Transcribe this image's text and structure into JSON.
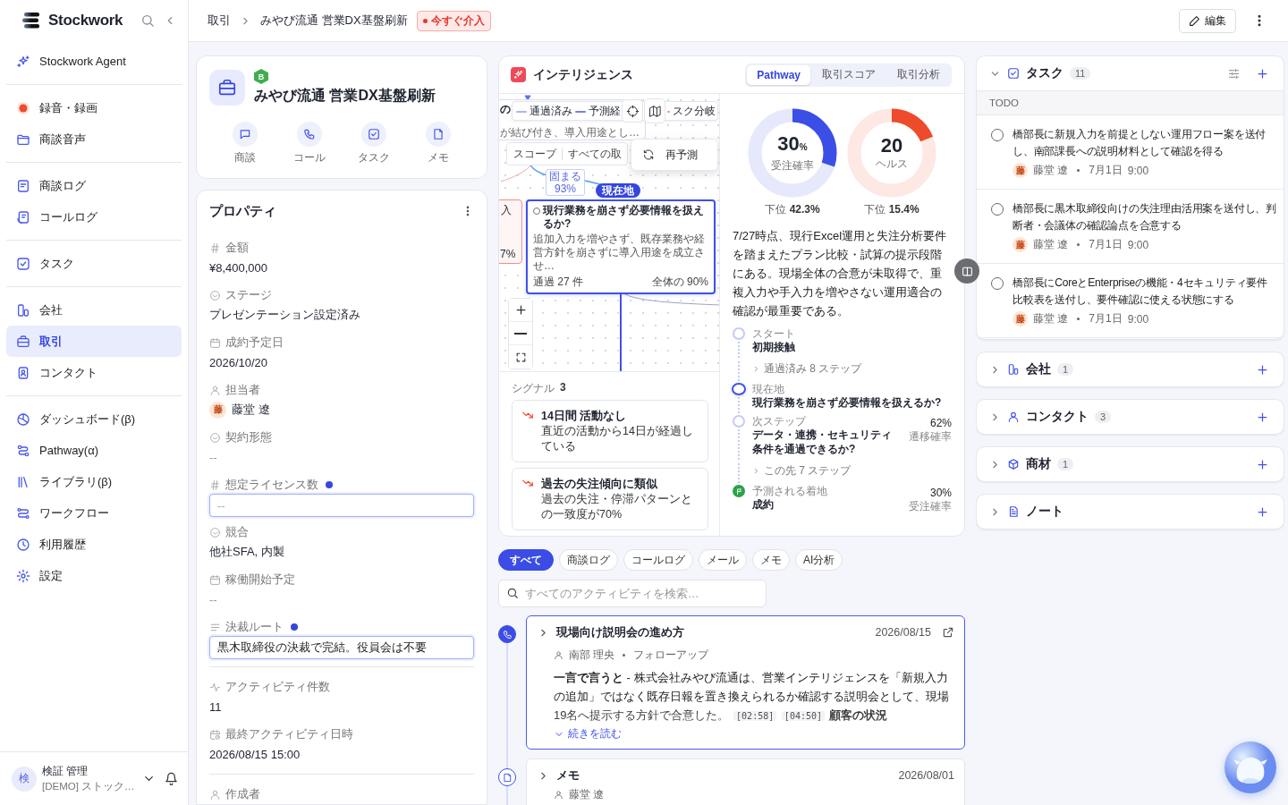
{
  "sidebar": {
    "brand": "Stockwork",
    "groups": [
      {
        "items": [
          {
            "label": "Stockwork Agent",
            "selected": false
          }
        ]
      },
      {
        "items": [
          {
            "label": "録音・録画",
            "selected": false
          },
          {
            "label": "商談音声",
            "selected": false
          }
        ]
      },
      {
        "items": [
          {
            "label": "商談ログ",
            "selected": false
          },
          {
            "label": "コールログ",
            "selected": false
          }
        ]
      },
      {
        "items": [
          {
            "label": "タスク",
            "selected": false
          }
        ]
      },
      {
        "items": [
          {
            "label": "会社",
            "selected": false
          },
          {
            "label": "取引",
            "selected": true
          },
          {
            "label": "コンタクト",
            "selected": false
          }
        ]
      },
      {
        "items": [
          {
            "label": "ダッシュボード(β)",
            "selected": false
          },
          {
            "label": "Pathway(α)",
            "selected": false
          },
          {
            "label": "ライブラリ(β)",
            "selected": false
          },
          {
            "label": "ワークフロー",
            "selected": false
          },
          {
            "label": "利用履歴",
            "selected": false
          },
          {
            "label": "設定",
            "selected": false
          }
        ]
      }
    ],
    "user": {
      "initial": "検",
      "name": "検証 管理",
      "org": "[DEMO] ストック…"
    }
  },
  "topbar": {
    "breadcrumb": [
      "取引",
      "みやび流通 営業DX基盤刷新"
    ],
    "alert": "今すぐ介入",
    "edit_button": "編集"
  },
  "deal": {
    "rank": "B",
    "title": "みやび流通 営業DX基盤刷新",
    "actions": [
      "商談",
      "コール",
      "タスク",
      "メモ"
    ]
  },
  "properties": {
    "title": "プロパティ",
    "groups": [
      {
        "fields": [
          {
            "kind": "number",
            "label": "金額",
            "value": "¥8,400,000"
          },
          {
            "kind": "select",
            "label": "ステージ",
            "value": "プレゼンテーション設定済み"
          },
          {
            "kind": "date",
            "label": "成約予定日",
            "value": "2026/10/20"
          },
          {
            "kind": "user",
            "label": "担当者",
            "value": "藤堂 遼",
            "initial": "藤"
          },
          {
            "kind": "select",
            "label": "契約形態",
            "value": "--"
          },
          {
            "kind": "number",
            "label": "想定ライセンス数",
            "editing": true,
            "placeholder": "--"
          },
          {
            "kind": "select",
            "label": "競合",
            "value": "他社SFA, 内製"
          },
          {
            "kind": "date",
            "label": "稼働開始予定",
            "value": "--"
          },
          {
            "kind": "text",
            "label": "決裁ルート",
            "editing": true,
            "value": "黒木取締役の決裁で完結。役員会は不要"
          }
        ]
      },
      {
        "fields": [
          {
            "kind": "activity",
            "label": "アクティビティ件数",
            "value": "11"
          },
          {
            "kind": "datetime",
            "label": "最終アクティビティ日時",
            "value": "2026/08/15 15:00"
          }
        ]
      },
      {
        "fields": [
          {
            "kind": "user",
            "label": "作成者"
          }
        ]
      }
    ]
  },
  "intelligence": {
    "title": "インテリジェンス",
    "tabs": [
      {
        "label": "Pathway",
        "selected": true
      },
      {
        "label": "取引スコア",
        "selected": false
      },
      {
        "label": "取引分析",
        "selected": false
      }
    ],
    "map": {
      "legend": [
        {
          "kind": "passed",
          "label": "通過済み"
        },
        {
          "kind": "predicted",
          "label": "予測経"
        },
        {
          "kind": "risk",
          "label": "スク分岐"
        }
      ],
      "scope": {
        "label": "スコープ",
        "value": "すべての取"
      },
      "menu": [
        "再予測"
      ],
      "edge_label": {
        "text": "固まる",
        "value": "93%"
      },
      "nodes": [
        {
          "kind": "partial-top",
          "title": "の",
          "description": "が結び付き、導入用途とし…"
        },
        {
          "kind": "partial-left",
          "title": "入",
          "footer": "7%"
        },
        {
          "kind": "current",
          "badge": "現在地",
          "title": "現行業務を崩さず必要情報を扱えるか?",
          "description": "追加入力を増やさず、既存業務や経営方針を崩さずに導入用途を成立させ…",
          "count": "通過 27 件",
          "share": "全体の 90%"
        }
      ]
    },
    "signals": {
      "label": "シグナル",
      "count": "3",
      "items": [
        {
          "title": "14日間 活動なし",
          "description": "直近の活動から14日が経過している"
        },
        {
          "title": "過去の失注傾向に類似",
          "description": "過去の失注・停滞パターンとの一致度が70%"
        }
      ]
    },
    "gauges": [
      {
        "value": "30",
        "unit": "%",
        "label": "受注確率",
        "level": 0.3,
        "color": "#3b4fe6",
        "footer_label": "下位",
        "footer_value": "42.3%"
      },
      {
        "value": "20",
        "label": "ヘルス",
        "level": 0.19,
        "color": "#ee4a2c",
        "footer_label": "下位",
        "footer_value": "15.4%"
      }
    ],
    "summary": "7/27時点、現行Excel運用と失注分析要件を踏まえたプラン比較・試算の提示段階にある。現場全体の合意が未取得で、重複入力や手入力を増やさない運用適合の確認が最重要である。",
    "steps": [
      {
        "kind": "start",
        "label": "スタート",
        "title": "初期接触"
      },
      {
        "kind": "collapsed",
        "label": "通過済み 8 ステップ"
      },
      {
        "kind": "current",
        "label": "現在地",
        "title": "現行業務を崩さず必要情報を扱えるか?"
      },
      {
        "kind": "next",
        "label": "次ステップ",
        "title": "データ・連携・セキュリティ条件を通過できるか?",
        "value": "62%",
        "value_label": "遷移確率"
      },
      {
        "kind": "collapsed",
        "label": "この先 7 ステップ"
      },
      {
        "kind": "landing",
        "label": "予測される着地",
        "title": "成約",
        "value": "30%",
        "value_label": "受注確率"
      }
    ]
  },
  "activity": {
    "filters": [
      {
        "label": "すべて",
        "selected": true
      },
      {
        "label": "商談ログ",
        "selected": false
      },
      {
        "label": "コールログ",
        "selected": false
      },
      {
        "label": "メール",
        "selected": false
      },
      {
        "label": "メモ",
        "selected": false
      },
      {
        "label": "AI分析",
        "selected": false
      }
    ],
    "search": {
      "placeholder": "すべてのアクティビティを検索…"
    },
    "items": [
      {
        "kind": "call",
        "selected": true,
        "title": "現場向け説明会の進め方",
        "date": "2026/08/15",
        "person": "南部 理央",
        "tag": "フォローアップ",
        "body": "**一言で言うと** - 株式会社みやび流通は、営業インテリジェンスを「新規入力の追加」ではなく既存日報を置き換えられるか確認する説明会として、現場19名へ提示する方針で合意した。",
        "timestamps": [
          "[02:58]",
          "[04:50]"
        ],
        "body_after": "顧客の状況",
        "more": "続きを読む"
      },
      {
        "kind": "memo",
        "selected": false,
        "title": "メモ",
        "date": "2026/08/01",
        "person": "藤堂 遼"
      }
    ]
  },
  "right_panel": {
    "tasks": {
      "title": "タスク",
      "count": "11",
      "expanded": true,
      "section": "TODO",
      "items": [
        {
          "text": "橋部長に新規入力を前提としない運用フロー案を送付し、南部課長への説明材料として確認を得る",
          "checked": false,
          "initial": "藤",
          "assignee": "藤堂 遼",
          "date": "7月1日",
          "time": "9:00"
        },
        {
          "text": "橋部長に黒木取締役向けの失注理由活用案を送付し、判断者・会議体の確認論点を合意する",
          "checked": false,
          "initial": "藤",
          "assignee": "藤堂 遼",
          "date": "7月1日",
          "time": "9:00"
        },
        {
          "text": "橋部長にCoreとEnterpriseの機能・4セキュリティ要件比較表を送付し、要件確認に使える状態にする",
          "checked": false,
          "initial": "藤",
          "assignee": "藤堂 遼",
          "date": "7月1日",
          "time": "9:00"
        }
      ]
    },
    "sections": [
      {
        "title": "会社",
        "count": "1",
        "expanded": false
      },
      {
        "title": "コンタクト",
        "count": "3",
        "expanded": false
      },
      {
        "title": "商材",
        "count": "1",
        "expanded": false
      },
      {
        "title": "ノート",
        "expanded": false
      }
    ]
  }
}
